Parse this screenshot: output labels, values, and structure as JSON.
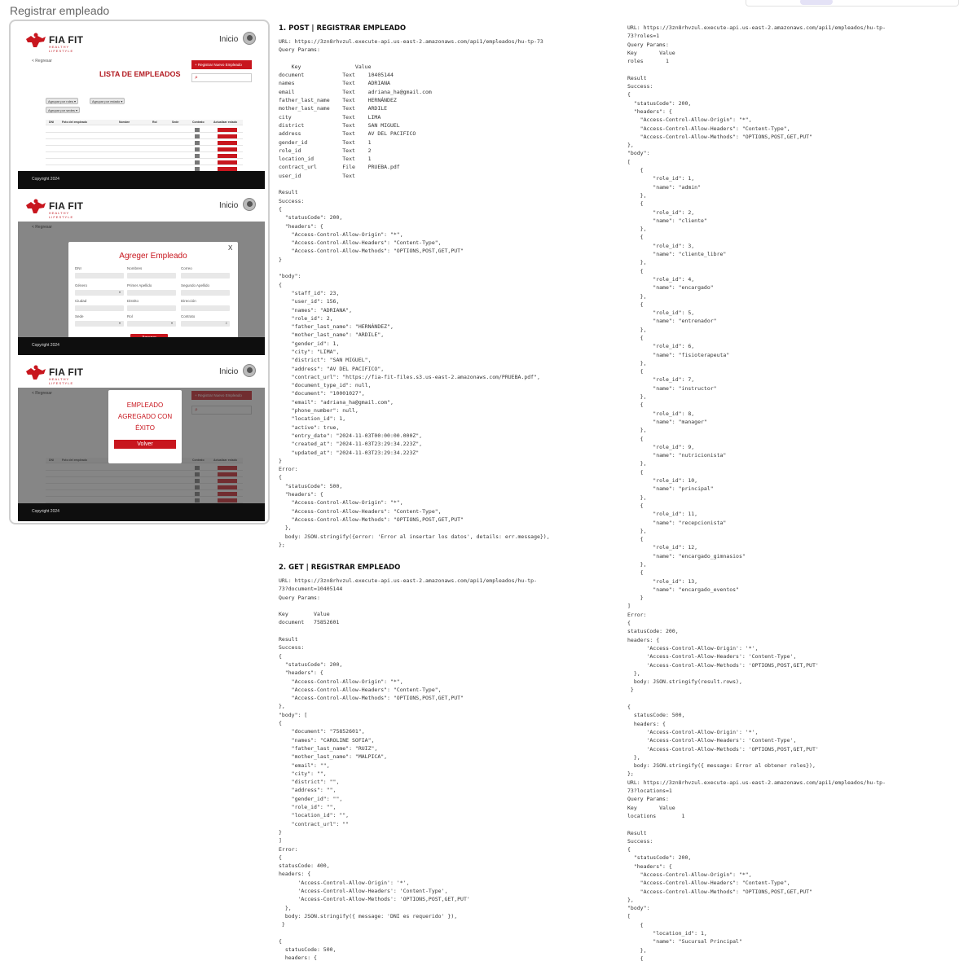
{
  "page": {
    "title": "Registrar empleado"
  },
  "app": {
    "brand": "FIA FIT",
    "tagline": "HEALTHY LIFESTYLE",
    "nav_inicio": "Inicio",
    "footer": "Copyright 2024",
    "back": "< Regresar",
    "list_title": "LISTA DE EMPLEADOS",
    "new_button": "+ Registrar Nuevo Empleado",
    "filter_role": "Agrupar por roles ▾",
    "filter_state": "Agrupar por estado ▾",
    "filter_sede": "Agrupar por sedes ▾",
    "table_headers": [
      "DNI",
      "Foto del empleado",
      "Nombre",
      "Rol",
      "Sede",
      "Contrato",
      "Actualizar estado"
    ],
    "modal_title": "Agreger Empleado",
    "modal_close": "X",
    "modal_fields": [
      "DNI",
      "Nombres",
      "Correo",
      "Género",
      "Primer Apellido",
      "Segundo Apellido",
      "Ciudad",
      "Distrito",
      "Dirección",
      "Sede",
      "Rol",
      "Contrato"
    ],
    "modal_submit": "Agregar",
    "success_text": "EMPLEADO AGREGADO CON ÉXITO",
    "success_button": "Volver"
  },
  "doc": {
    "sec1_title": "1. POST | REGISTRAR EMPLEADO",
    "sec1_body": "URL: https://3zn8rhvzul.execute-api.us-east-2.amazonaws.com/api1/empleados/hu-tp-73\nQuery Params:\n\n    Key                 Value\ndocument            Text    10405144\nnames               Text    ADRIANA\nemail               Text    adriana_ha@gmail.com\nfather_last_name    Text    HERNÁNDEZ\nmother_last_name    Text    ARDILE\ncity                Text    LIMA\ndistrict            Text    SAN MIGUEL\naddress             Text    AV DEL PACIFICO\ngender_id           Text    1\nrole_id             Text    2\nlocation_id         Text    1\ncontract_url        File    PRUEBA.pdf\nuser_id             Text\n\nResult\nSuccess:\n{\n  \"statusCode\": 200,\n  \"headers\": {\n    \"Access-Control-Allow-Origin\": \"*\",\n    \"Access-Control-Allow-Headers\": \"Content-Type\",\n    \"Access-Control-Allow-Methods\": \"OPTIONS,POST,GET,PUT\"\n}\n\n\"body\":\n{\n    \"staff_id\": 23,\n    \"user_id\": 156,\n    \"names\": \"ADRIANA\",\n    \"role_id\": 2,\n    \"father_last_name\": \"HERNÁNDEZ\",\n    \"mother_last_name\": \"ARDILE\",\n    \"gender_id\": 1,\n    \"city\": \"LIMA\",\n    \"district\": \"SAN MIGUEL\",\n    \"address\": \"AV DEL PACIFICO\",\n    \"contract_url\": \"https://fia-fit-files.s3.us-east-2.amazonaws.com/PRUEBA.pdf\",\n    \"document_type_id\": null,\n    \"document\": \"10001027\",\n    \"email\": \"adriana_ha@gmail.com\",\n    \"phone_number\": null,\n    \"location_id\": 1,\n    \"active\": true,\n    \"entry_date\": \"2024-11-03T00:00:00.000Z\",\n    \"created_at\": \"2024-11-03T23:29:34.223Z\",\n    \"updated_at\": \"2024-11-03T23:29:34.223Z\"\n}\nError:\n{\n  \"statusCode\": 500,\n  \"headers\": {\n    \"Access-Control-Allow-Origin\": \"*\",\n    \"Access-Control-Allow-Headers\": \"Content-Type\",\n    \"Access-Control-Allow-Methods\": \"OPTIONS,POST,GET,PUT\"\n  },\n  body: JSON.stringify({error: 'Error al insertar los datos', details: err.message}),\n};",
    "sec2_title": "2. GET | REGISTRAR EMPLEADO",
    "sec2_body": "URL: https://3zn8rhvzul.execute-api.us-east-2.amazonaws.com/api1/empleados/hu-tp-\n73?document=10405144\nQuery Params:\n\nKey        Value\ndocument   75852601\n\nResult\nSuccess:\n{\n  \"statusCode\": 200,\n  \"headers\": {\n    \"Access-Control-Allow-Origin\": \"*\",\n    \"Access-Control-Allow-Headers\": \"Content-Type\",\n    \"Access-Control-Allow-Methods\": \"OPTIONS,POST,GET,PUT\"\n},\n\"body\": [\n{\n    \"document\": \"75852601\",\n    \"names\": \"CAROLINE SOFIA\",\n    \"father_last_name\": \"RUIZ\",\n    \"mother_last_name\": \"MALPICA\",\n    \"email\": \"\",\n    \"city\": \"\",\n    \"district\": \"\",\n    \"address\": \"\",\n    \"gender_id\": \"\",\n    \"role_id\": \"\",\n    \"location_id\": \"\",\n    \"contract_url\": \"\"\n}\n]\nError:\n{\nstatusCode: 400,\nheaders: {\n      'Access-Control-Allow-Origin': '*',\n      'Access-Control-Allow-Headers': 'Content-Type',\n      'Access-Control-Allow-Methods': 'OPTIONS,POST,GET,PUT'\n  },\n  body: JSON.stringify({ message: 'DNI es requerido' }),\n }\n\n{\n  statusCode: 500,\n  headers: {",
    "col3_body": "URL: https://3zn8rhvzul.execute-api.us-east-2.amazonaws.com/api1/empleados/hu-tp-\n73?roles=1\nQuery Params:\nKey       Value\nroles       1\n\nResult\nSuccess:\n{\n  \"statusCode\": 200,\n  \"headers\": {\n    \"Access-Control-Allow-Origin\": \"*\",\n    \"Access-Control-Allow-Headers\": \"Content-Type\",\n    \"Access-Control-Allow-Methods\": \"OPTIONS,POST,GET,PUT\"\n},\n\"body\":\n[\n    {\n        \"role_id\": 1,\n        \"name\": \"admin\"\n    },\n    {\n        \"role_id\": 2,\n        \"name\": \"cliente\"\n    },\n    {\n        \"role_id\": 3,\n        \"name\": \"cliente_libre\"\n    },\n    {\n        \"role_id\": 4,\n        \"name\": \"encargado\"\n    },\n    {\n        \"role_id\": 5,\n        \"name\": \"entrenador\"\n    },\n    {\n        \"role_id\": 6,\n        \"name\": \"fisioterapeuta\"\n    },\n    {\n        \"role_id\": 7,\n        \"name\": \"instructor\"\n    },\n    {\n        \"role_id\": 8,\n        \"name\": \"manager\"\n    },\n    {\n        \"role_id\": 9,\n        \"name\": \"nutricionista\"\n    },\n    {\n        \"role_id\": 10,\n        \"name\": \"principal\"\n    },\n    {\n        \"role_id\": 11,\n        \"name\": \"recepcionista\"\n    },\n    {\n        \"role_id\": 12,\n        \"name\": \"encargado_gimnasios\"\n    },\n    {\n        \"role_id\": 13,\n        \"name\": \"encargado_eventos\"\n    }\n]\nError:\n{\nstatusCode: 200,\nheaders: {\n      'Access-Control-Allow-Origin': '*',\n      'Access-Control-Allow-Headers': 'Content-Type',\n      'Access-Control-Allow-Methods': 'OPTIONS,POST,GET,PUT'\n  },\n  body: JSON.stringify(result.rows),\n }\n\n{\n  statusCode: 500,\n  headers: {\n      'Access-Control-Allow-Origin': '*',\n      'Access-Control-Allow-Headers': 'Content-Type',\n      'Access-Control-Allow-Methods': 'OPTIONS,POST,GET,PUT'\n  },\n  body: JSON.stringify({ message: Error al obtener roles}),\n};\nURL: https://3zn8rhvzul.execute-api.us-east-2.amazonaws.com/api1/empleados/hu-tp-\n73?locations=1\nQuery Params:\nKey       Value\nlocations        1\n\nResult\nSuccess:\n{\n  \"statusCode\": 200,\n  \"headers\": {\n    \"Access-Control-Allow-Origin\": \"*\",\n    \"Access-Control-Allow-Headers\": \"Content-Type\",\n    \"Access-Control-Allow-Methods\": \"OPTIONS,POST,GET,PUT\"\n},\n\"body\":\n[\n    {\n        \"location_id\": 1,\n        \"name\": \"Sucursal Principal\"\n    },\n    {"
  },
  "colors": {
    "accent": "#c8161e",
    "footer": "#0e0e0e",
    "title_red": "#b31b22"
  }
}
